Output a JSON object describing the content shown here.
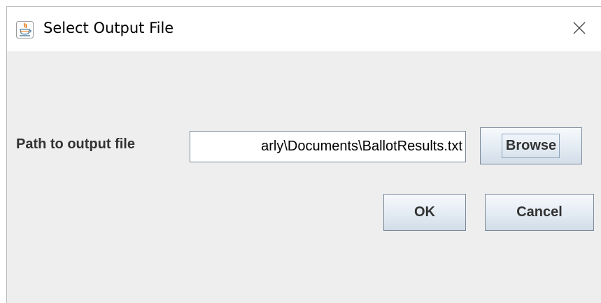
{
  "window": {
    "title": "Select Output File",
    "app_icon": "java-icon",
    "close_icon": "close-icon"
  },
  "form": {
    "path_label": "Path to output file",
    "path_value": "arly\\Documents\\BallotResults.txt",
    "browse_label": "Browse"
  },
  "actions": {
    "ok_label": "OK",
    "cancel_label": "Cancel"
  },
  "colors": {
    "dialog_background": "#eeeeee",
    "titlebar_background": "#ffffff",
    "button_border": "#7a8a99",
    "label_text": "#333333"
  }
}
